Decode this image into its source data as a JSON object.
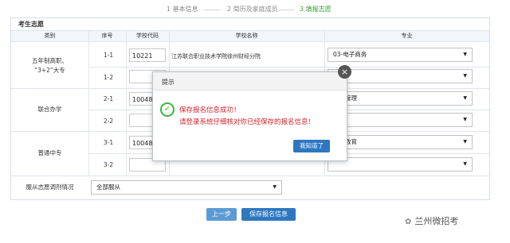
{
  "steps": [
    {
      "label": "1 基本信息",
      "active": false
    },
    {
      "label": "2 简历及家庭成员",
      "active": false
    },
    {
      "label": "3 填报志愿",
      "active": true
    }
  ],
  "panel": {
    "title": "考生志愿",
    "headers": [
      "类别",
      "序号",
      "学校代码",
      "学校名称",
      "专业"
    ]
  },
  "groups": [
    {
      "category_line1": "五年制高职、",
      "category_line2": "“3+2”大专",
      "rows": [
        {
          "seq": "1-1",
          "code": "10221",
          "school": "江苏联合职业技术学院徐州财经分院",
          "major": "03-电子商务"
        },
        {
          "seq": "1-2",
          "code": "",
          "school": "",
          "major": ""
        }
      ]
    },
    {
      "category_line1": "联合办学",
      "category_line2": "",
      "rows": [
        {
          "seq": "2-1",
          "code": "10048",
          "school": "",
          "major": "酒店管理"
        },
        {
          "seq": "2-2",
          "code": "",
          "school": "",
          "major": ""
        }
      ]
    },
    {
      "category_line1": "普通中专",
      "category_line2": "",
      "rows": [
        {
          "seq": "3-1",
          "code": "10048",
          "school": "",
          "major": "学前教育"
        },
        {
          "seq": "3-2",
          "code": "",
          "school": "",
          "major": ""
        }
      ]
    }
  ],
  "adjust": {
    "label": "服从志愿调剂情况",
    "value": "全部服从"
  },
  "buttons": {
    "prev": "上一步",
    "save": "保存报名信息"
  },
  "dialog": {
    "title": "提示",
    "close": "×",
    "check": "✓",
    "line1": "保存报名信息成功！",
    "line2": "请登录系统仔细核对你已经保存的报名信息！",
    "ok": "我知道了"
  },
  "watermark": {
    "text": "兰州微招考"
  },
  "icons": {
    "dropdown": "▼"
  }
}
